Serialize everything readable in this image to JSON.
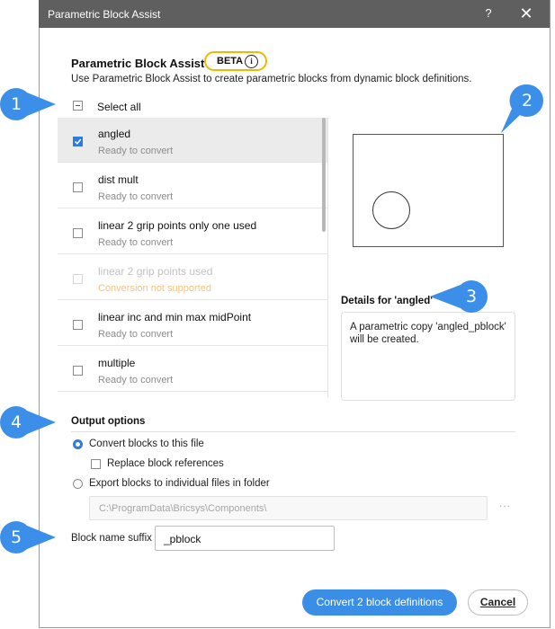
{
  "window": {
    "title": "Parametric Block Assist",
    "help_glyph": "?",
    "close_glyph": "✕"
  },
  "header": {
    "heading": "Parametric Block Assist",
    "badge": "BETA",
    "info_glyph": "i",
    "description": "Use Parametric Block Assist to create parametric blocks from dynamic block definitions."
  },
  "select_all": {
    "label": "Select all",
    "state": "indeterminate"
  },
  "blocks": [
    {
      "name": "angled",
      "status": "Ready to convert",
      "checked": true,
      "disabled": false,
      "selected": true
    },
    {
      "name": "dist mult",
      "status": "Ready to convert",
      "checked": false,
      "disabled": false,
      "selected": false
    },
    {
      "name": "linear 2 grip points only one used",
      "status": "Ready to convert",
      "checked": false,
      "disabled": false,
      "selected": false
    },
    {
      "name": "linear 2 grip points used",
      "status": "Conversion not supported",
      "checked": false,
      "disabled": true,
      "selected": false
    },
    {
      "name": "linear inc and min max midPoint",
      "status": "Ready to convert",
      "checked": false,
      "disabled": false,
      "selected": false
    },
    {
      "name": "multiple",
      "status": "Ready to convert",
      "checked": false,
      "disabled": false,
      "selected": false
    }
  ],
  "details": {
    "title": "Details for 'angled'",
    "text": "A parametric copy 'angled_pblock' will be created."
  },
  "output": {
    "title": "Output options",
    "convert_label": "Convert blocks to this file",
    "replace_label": "Replace block references",
    "export_label": "Export blocks to individual files in folder",
    "folder_value": "C:\\ProgramData\\Bricsys\\Components\\",
    "browse_glyph": "···"
  },
  "suffix": {
    "label": "Block name suffix",
    "value": "_pblock"
  },
  "buttons": {
    "convert": "Convert 2 block definitions",
    "cancel": "Cancel"
  },
  "callouts": [
    "1",
    "2",
    "3",
    "4",
    "5"
  ],
  "colors": {
    "accent": "#3a8ee6",
    "callout": "#3b8fe8",
    "badge_border": "#f2b800",
    "titlebar": "#5f5f5f"
  }
}
